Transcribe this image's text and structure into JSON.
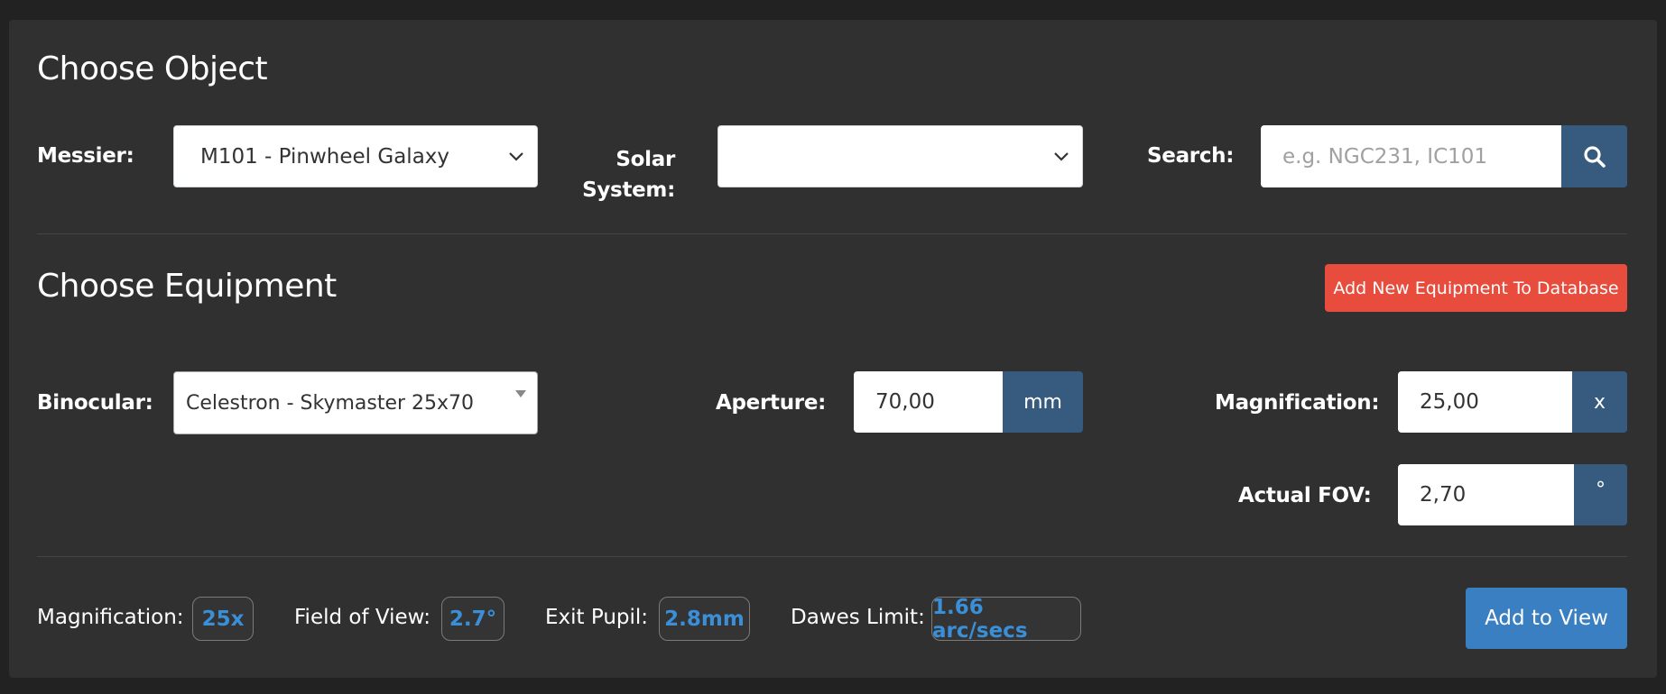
{
  "object_section": {
    "title": "Choose Object",
    "messier_label": "Messier:",
    "messier_value": "M101 - Pinwheel Galaxy",
    "solar_label_line1": "Solar",
    "solar_label_line2": "System:",
    "solar_value": "",
    "search_label": "Search:",
    "search_placeholder": "e.g. NGC231, IC101"
  },
  "equipment_section": {
    "title": "Choose Equipment",
    "add_equipment_button": "Add New Equipment To Database",
    "binocular_label": "Binocular:",
    "binocular_value": "Celestron - Skymaster 25x70",
    "aperture_label": "Aperture:",
    "aperture_value": "70,00",
    "aperture_unit": "mm",
    "magnification_label": "Magnification:",
    "magnification_value": "25,00",
    "magnification_unit": "x",
    "fov_label": "Actual FOV:",
    "fov_value": "2,70",
    "fov_unit": "°"
  },
  "stats": {
    "magnification_label": "Magnification:",
    "magnification_value": "25x",
    "fov_label": "Field of View:",
    "fov_value": "2.7°",
    "exit_pupil_label": "Exit Pupil:",
    "exit_pupil_value": "2.8mm",
    "dawes_label": "Dawes Limit:",
    "dawes_value": "1.66 arc/secs",
    "add_to_view_button": "Add to View"
  },
  "colors": {
    "background": "#222222",
    "panel": "#303030",
    "addon": "#375a7f",
    "danger": "#e74c3c",
    "primary": "#3a7fc1",
    "badge_text": "#3a8fd9"
  },
  "icons": {
    "search": "search-icon",
    "chevron": "chevron-down-icon",
    "caret": "caret-down-icon"
  }
}
